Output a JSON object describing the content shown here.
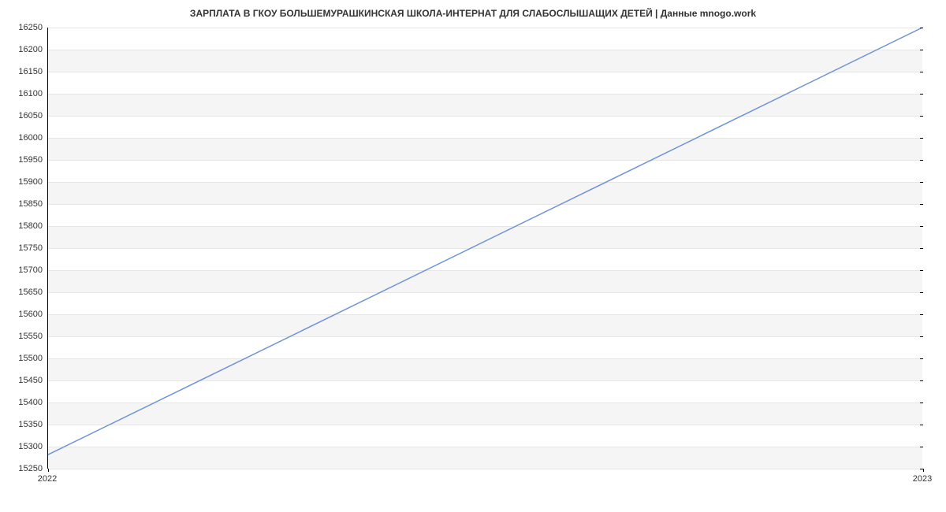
{
  "chart_data": {
    "type": "line",
    "title": "ЗАРПЛАТА В ГКОУ БОЛЬШЕМУРАШКИНСКАЯ ШКОЛА-ИНТЕРНАТ ДЛЯ СЛАБОСЛЫШАЩИХ ДЕТЕЙ | Данные mnogo.work",
    "xlabel": "",
    "ylabel": "",
    "x_categories": [
      "2022",
      "2023"
    ],
    "x": [
      2022,
      2023
    ],
    "values": [
      15280,
      16250
    ],
    "y_ticks": [
      15250,
      15300,
      15350,
      15400,
      15450,
      15500,
      15550,
      15600,
      15650,
      15700,
      15750,
      15800,
      15850,
      15900,
      15950,
      16000,
      16050,
      16100,
      16150,
      16200,
      16250
    ],
    "ylim": [
      15250,
      16250
    ],
    "xlim": [
      2022,
      2023
    ],
    "line_color": "#6f94d6",
    "band_color": "#f5f5f5"
  }
}
